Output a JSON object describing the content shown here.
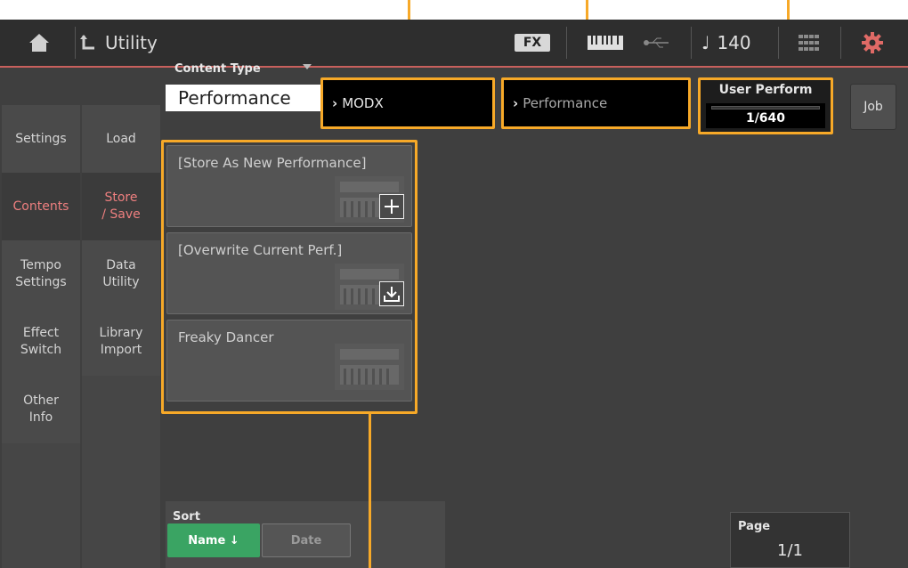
{
  "header": {
    "title": "Utility",
    "fx_label": "FX",
    "tempo_glyph": "♩",
    "tempo_value": "140"
  },
  "left_menu": {
    "col1": [
      "Settings",
      "Contents",
      "Tempo\nSettings",
      "Effect\nSwitch",
      "Other\nInfo"
    ],
    "col2": [
      "Load",
      "Store\n/ Save",
      "Data\nUtility",
      "Library\nImport"
    ],
    "selected": "Contents",
    "selected_sub": "Store / Save"
  },
  "content_type": {
    "label": "Content Type",
    "value": "Performance"
  },
  "path": {
    "level1": "MODX",
    "level2": "Performance"
  },
  "bank": {
    "title": "User Perform",
    "count": "1/640"
  },
  "job_label": "Job",
  "list": {
    "items": [
      {
        "label": "[Store As New Performance]",
        "icon": "plus-icon"
      },
      {
        "label": "[Overwrite Current Perf.]",
        "icon": "download-icon"
      },
      {
        "label": "Freaky Dancer",
        "icon": ""
      }
    ]
  },
  "sort": {
    "label": "Sort",
    "name": "Name ↓",
    "date": "Date",
    "active": "Name"
  },
  "page": {
    "label": "Page",
    "value": "1/1"
  },
  "colors": {
    "accent": "#f7a928",
    "selected_text": "#ee7f7f",
    "sort_active": "#3aa463",
    "header_line": "#c8605d"
  }
}
